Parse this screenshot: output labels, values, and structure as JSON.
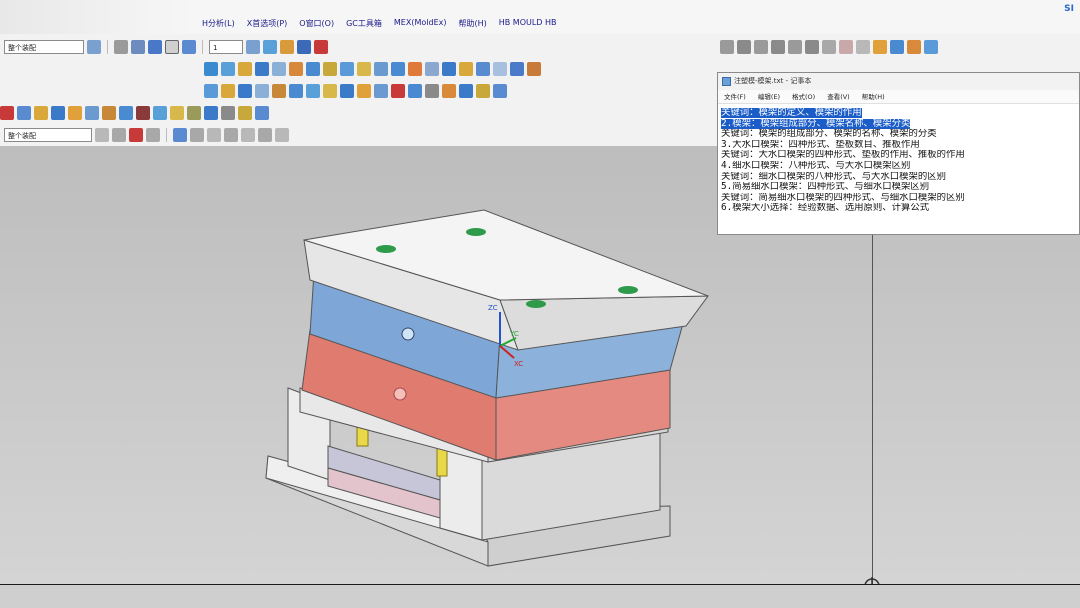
{
  "menubar": {
    "items": [
      "H分析(L)",
      "X首选项(P)",
      "O窗口(O)",
      "GC工具箱",
      "MEX(MoldEx)",
      "帮助(H)",
      "HB MOULD HB"
    ],
    "brand": "SI"
  },
  "toolbar": {
    "filter_dropdown": "整个装配",
    "snap_dropdown": "整个装配",
    "scale_value": "1"
  },
  "notepad": {
    "title": "注塑模-模架.txt - 记事本",
    "menu": [
      "文件(F)",
      "编辑(E)",
      "格式(O)",
      "查看(V)",
      "帮助(H)"
    ],
    "lines": [
      "关键词：模架的定义、模架的作用",
      "2.模架：模架组成部分、模架名称、模架分类",
      "关键词：模架的组成部分、模架的名称、模架的分类",
      "3.大水口模架：四种形式、垫板数目、推板作用",
      "关键词：大水口模架的四种形式、垫板的作用、推板的作用",
      "4.细水口模架：八种形式、与大水口模架区别",
      "关键词：细水口模架的八种形式、与大水口模架的区别",
      "5.简易细水口模架：四种形式、与细水口模架区别",
      "关键词：简易细水口模架的四种形式、与细水口模架的区别",
      "6.模架大小选择：经验数据、选用原则、计算公式"
    ],
    "selected_lines": [
      0,
      1
    ]
  },
  "axes": {
    "zc": "ZC",
    "yc": "YC",
    "xc": "XC"
  },
  "colors": {
    "cavity_plate": "#7ea6d6",
    "core_plate": "#e07b6f",
    "plate_gray": "#e6e6e6",
    "guide_green": "#2e9a4a",
    "ejector_pin": "#e8d84a",
    "selection": "#1a5cc8"
  }
}
